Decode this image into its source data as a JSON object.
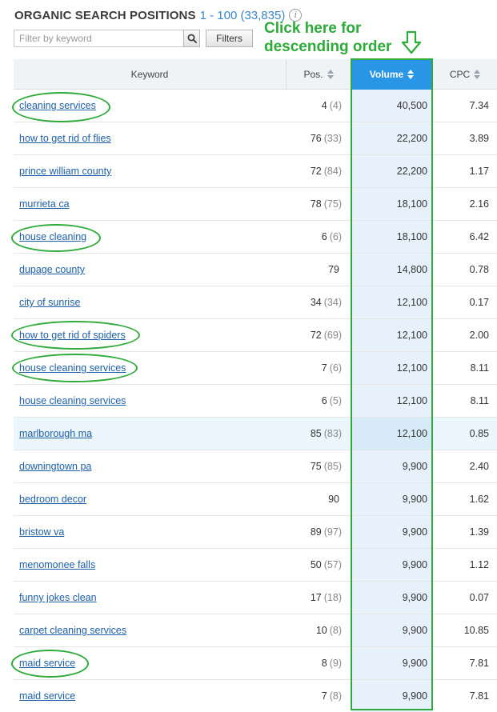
{
  "header": {
    "title": "ORGANIC SEARCH POSITIONS",
    "range": "1 - 100 (33,835)",
    "info_glyph": "i"
  },
  "filter": {
    "placeholder": "Filter by keyword",
    "value": "",
    "filters_label": "Filters"
  },
  "annotation": {
    "line1": "Click here for",
    "line2": "descending order"
  },
  "columns": {
    "keyword": "Keyword",
    "pos": "Pos.",
    "volume": "Volume",
    "cpc": "CPC"
  },
  "rows": [
    {
      "keyword": "cleaning services",
      "pos": "4",
      "prev": "(4)",
      "volume": "40,500",
      "cpc": "7.34"
    },
    {
      "keyword": "how to get rid of flies",
      "pos": "76",
      "prev": "(33)",
      "volume": "22,200",
      "cpc": "3.89"
    },
    {
      "keyword": "prince william county",
      "pos": "72",
      "prev": "(84)",
      "volume": "22,200",
      "cpc": "1.17"
    },
    {
      "keyword": "murrieta ca",
      "pos": "78",
      "prev": "(75)",
      "volume": "18,100",
      "cpc": "2.16"
    },
    {
      "keyword": "house cleaning",
      "pos": "6",
      "prev": "(6)",
      "volume": "18,100",
      "cpc": "6.42"
    },
    {
      "keyword": "dupage county",
      "pos": "79",
      "prev": "",
      "volume": "14,800",
      "cpc": "0.78"
    },
    {
      "keyword": "city of sunrise",
      "pos": "34",
      "prev": "(34)",
      "volume": "12,100",
      "cpc": "0.17"
    },
    {
      "keyword": "how to get rid of spiders",
      "pos": "72",
      "prev": "(69)",
      "volume": "12,100",
      "cpc": "2.00"
    },
    {
      "keyword": "house cleaning services",
      "pos": "7",
      "prev": "(6)",
      "volume": "12,100",
      "cpc": "8.11"
    },
    {
      "keyword": "house cleaning services",
      "pos": "6",
      "prev": "(5)",
      "volume": "12,100",
      "cpc": "8.11"
    },
    {
      "keyword": "marlborough ma",
      "pos": "85",
      "prev": "(83)",
      "volume": "12,100",
      "cpc": "0.85"
    },
    {
      "keyword": "downingtown pa",
      "pos": "75",
      "prev": "(85)",
      "volume": "9,900",
      "cpc": "2.40"
    },
    {
      "keyword": "bedroom decor",
      "pos": "90",
      "prev": "",
      "volume": "9,900",
      "cpc": "1.62"
    },
    {
      "keyword": "bristow va",
      "pos": "89",
      "prev": "(97)",
      "volume": "9,900",
      "cpc": "1.39"
    },
    {
      "keyword": "menomonee falls",
      "pos": "50",
      "prev": "(57)",
      "volume": "9,900",
      "cpc": "1.12"
    },
    {
      "keyword": "funny jokes clean",
      "pos": "17",
      "prev": "(18)",
      "volume": "9,900",
      "cpc": "0.07"
    },
    {
      "keyword": "carpet cleaning services",
      "pos": "10",
      "prev": "(8)",
      "volume": "9,900",
      "cpc": "10.85"
    },
    {
      "keyword": "maid service",
      "pos": "8",
      "prev": "(9)",
      "volume": "9,900",
      "cpc": "7.81"
    },
    {
      "keyword": "maid service",
      "pos": "7",
      "prev": "(8)",
      "volume": "9,900",
      "cpc": "7.81"
    }
  ],
  "highlighted_row": 10,
  "sorted_column": "volume",
  "colors": {
    "accent": "#2a96e6",
    "link": "#1e5fa6",
    "annotation": "#2eaa3a"
  },
  "icons": {
    "search": "magnifier-icon",
    "info": "info-icon",
    "sort": "sort-arrows-icon",
    "annotation_arrow": "down-arrow-icon"
  }
}
